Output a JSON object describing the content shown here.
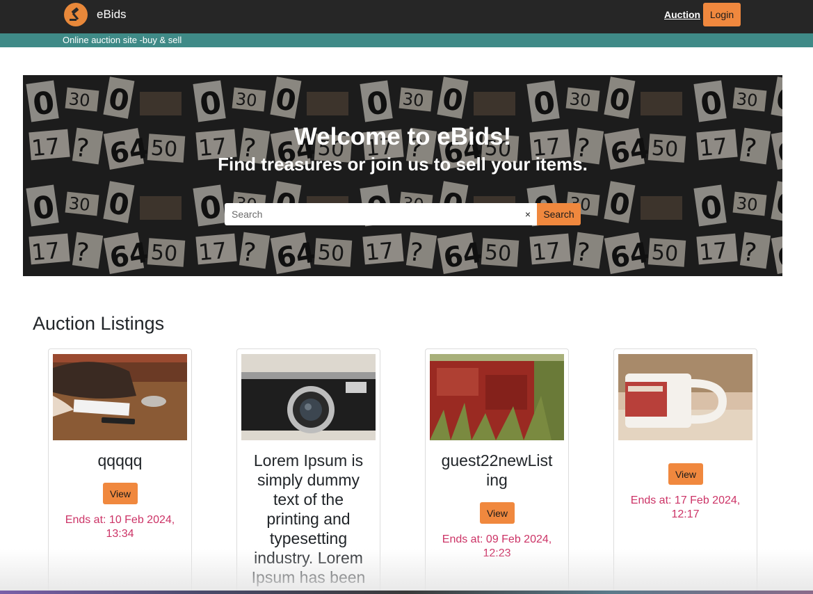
{
  "header": {
    "brand": "eBids",
    "nav_link": "Auction",
    "login_label": "Login"
  },
  "tagline": "Online auction site -buy & sell",
  "hero": {
    "title": "Welcome to eBids!",
    "subtitle": "Find treasures or join us to sell your items.",
    "search_placeholder": "Search",
    "clear_symbol": "×",
    "search_button": "Search"
  },
  "listings": {
    "heading": "Auction Listings",
    "view_label": "View",
    "items": [
      {
        "title": "qqqqq",
        "ends": "Ends at: 10 Feb 2024, 13:34"
      },
      {
        "title": "Lorem Ipsum is simply dummy text of the printing and typesetting industry. Lorem Ipsum has been the industry's",
        "ends": ""
      },
      {
        "title": "guest22newListing",
        "ends": "Ends at: 09 Feb 2024, 12:23"
      },
      {
        "title": "",
        "ends": "Ends at: 17 Feb 2024, 12:17"
      }
    ]
  },
  "colors": {
    "navbar": "#262626",
    "tagline_bg": "#3f8a87",
    "accent": "#f0883e",
    "ends_text": "#cc3366"
  }
}
